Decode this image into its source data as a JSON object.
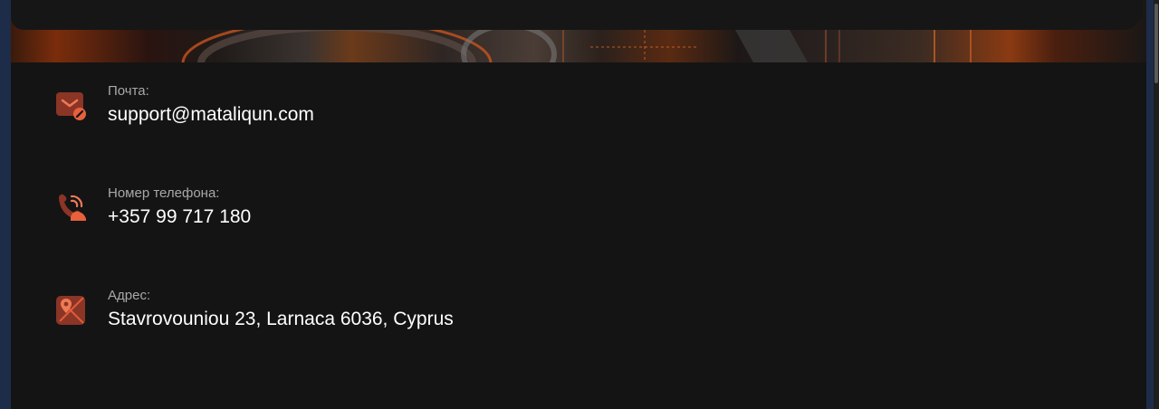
{
  "colors": {
    "accent": "#e8603c",
    "accent_dark": "#8a3526",
    "panel_bg": "#141414",
    "label": "#a8a8a8",
    "value": "#ffffff"
  },
  "contacts": [
    {
      "icon": "mail-icon",
      "label": "Почта:",
      "value": "support@mataliqun.com"
    },
    {
      "icon": "phone-icon",
      "label": "Номер телефона:",
      "value": "+357 99 717 180"
    },
    {
      "icon": "map-pin-icon",
      "label": "Адрес:",
      "value": "Stavrovouniou 23, Larnaca 6036, Cyprus"
    }
  ]
}
